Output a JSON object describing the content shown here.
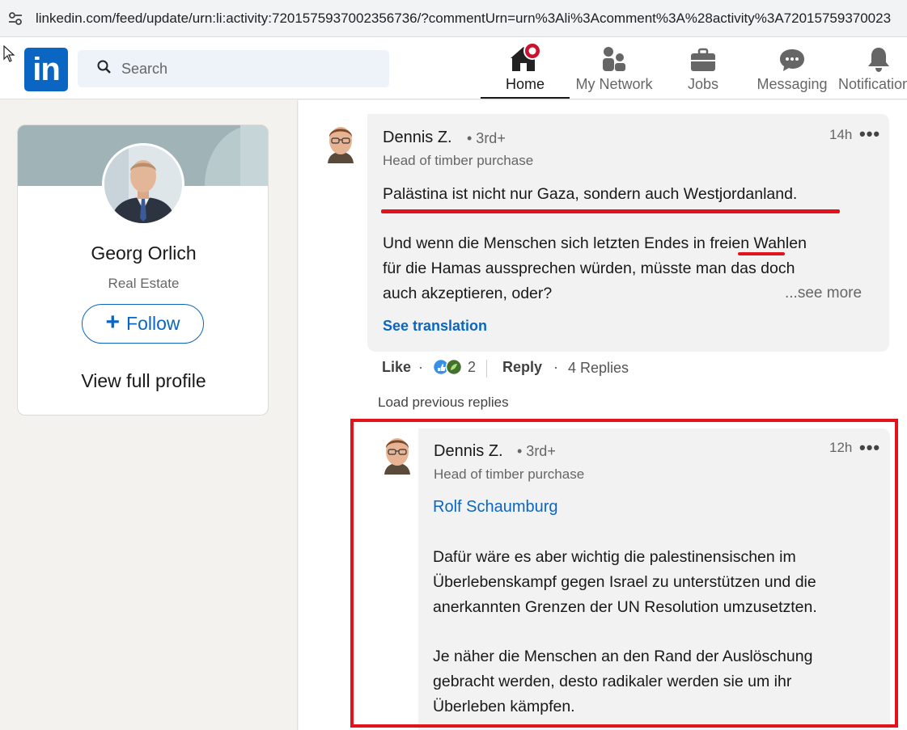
{
  "browser": {
    "url": "linkedin.com/feed/update/urn:li:activity:7201575937002356736/?commentUrn=urn%3Ali%3Acomment%3A%28activity%3A72015759370023"
  },
  "nav": {
    "logo": "in",
    "search_placeholder": "Search",
    "items": [
      {
        "label": "Home",
        "icon": "home-icon"
      },
      {
        "label": "My Network",
        "icon": "network-icon"
      },
      {
        "label": "Jobs",
        "icon": "briefcase-icon"
      },
      {
        "label": "Messaging",
        "icon": "messaging-icon"
      },
      {
        "label": "Notifications",
        "icon": "bell-icon"
      }
    ]
  },
  "profile_card": {
    "name": "Georg Orlich",
    "headline": "Real Estate",
    "follow_label": "Follow",
    "view_profile_label": "View full profile"
  },
  "comment": {
    "author": "Dennis Z.",
    "degree": "• 3rd+",
    "headline": "Head of timber purchase",
    "time": "14h",
    "more": "•••",
    "line1": "Palästina ist nicht nur Gaza, sondern auch Westjordanland.",
    "para2_line1_a": "Und wenn die Menschen sich letzten Endes in ",
    "para2_line1_word": "freien",
    "para2_line1_b": " Wahlen",
    "para2_line2": "für die Hamas aussprechen würden, müsste man das doch",
    "para2_line3": "auch akzeptieren, oder?",
    "see_more": "...see more",
    "see_translation": "See translation",
    "like": "Like",
    "reaction_count": "2",
    "reply": "Reply",
    "replies": "4 Replies",
    "separator": "·"
  },
  "load_previous": "Load previous replies",
  "reply_comment": {
    "author": "Dennis Z.",
    "degree": "• 3rd+",
    "headline": "Head of timber purchase",
    "time": "12h",
    "more": "•••",
    "mention": "Rolf Schaumburg",
    "p1_l1": "Dafür wäre es aber wichtig die palestinensischen im",
    "p1_l2": "Überlebenskampf gegen Israel zu unterstützen und die",
    "p1_l3": "anerkannten Grenzen der UN Resolution umzusetzten.",
    "p2_l1": "Je näher die Menschen an den Rand der Auslöschung",
    "p2_l2": "gebracht werden, desto radikaler werden sie um ihr",
    "p2_l3": "Überleben kämpfen."
  },
  "colors": {
    "linkedin_blue": "#0a66c2",
    "highlight_red": "#e3131b"
  }
}
